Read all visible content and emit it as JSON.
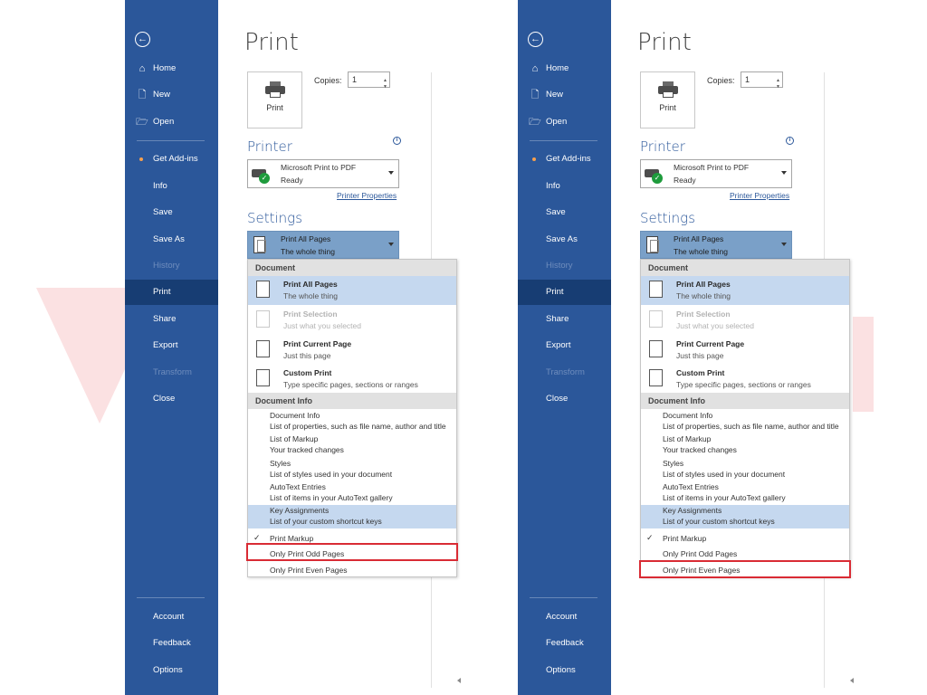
{
  "sidebar": {
    "items": [
      {
        "label": "Home",
        "icon": "home-icon"
      },
      {
        "label": "New",
        "icon": "new-document-icon"
      },
      {
        "label": "Open",
        "icon": "open-folder-icon"
      },
      {
        "label": "Get Add-ins",
        "icon": "addins-dot-icon"
      },
      {
        "label": "Info"
      },
      {
        "label": "Save"
      },
      {
        "label": "Save As"
      },
      {
        "label": "History",
        "disabled": true
      },
      {
        "label": "Print",
        "selected": true
      },
      {
        "label": "Share"
      },
      {
        "label": "Export"
      },
      {
        "label": "Transform",
        "disabled": true
      },
      {
        "label": "Close"
      },
      {
        "label": "Account"
      },
      {
        "label": "Feedback"
      },
      {
        "label": "Options"
      }
    ],
    "back_icon": "back-arrow-icon"
  },
  "main": {
    "title": "Print",
    "print_button": "Print",
    "copies_label": "Copies:",
    "copies_value": "1",
    "printer_heading": "Printer",
    "printer_name": "Microsoft Print to PDF",
    "printer_status": "Ready",
    "printer_properties": "Printer Properties",
    "settings_heading": "Settings",
    "settings_title": "Print All Pages",
    "settings_sub": "The whole thing"
  },
  "menu": {
    "document_head": "Document",
    "items": [
      {
        "title": "Print All Pages",
        "sub": "The whole thing",
        "highlighted": true
      },
      {
        "title": "Print Selection",
        "sub": "Just what you selected",
        "disabled": true
      },
      {
        "title": "Print Current Page",
        "sub": "Just this page"
      },
      {
        "title": "Custom Print",
        "sub": "Type specific pages, sections or ranges"
      }
    ],
    "docinfo_head": "Document Info",
    "docinfo_items": [
      {
        "title": "Document Info",
        "sub": "List of properties, such as file name, author and title"
      },
      {
        "title": "List of Markup",
        "sub": "Your tracked changes"
      },
      {
        "title": "Styles",
        "sub": "List of styles used in your document"
      },
      {
        "title": "AutoText Entries",
        "sub": "List of items in your AutoText gallery"
      },
      {
        "title": "Key Assignments",
        "sub": "List of your custom shortcut keys",
        "highlighted": true
      }
    ],
    "print_markup": "Print Markup",
    "check": "✓",
    "odd_pages": "Only Print Odd Pages",
    "even_pages": "Only Print Even Pages"
  },
  "annotations": {
    "left_highlight": "Only Print Odd Pages",
    "right_highlight": "Only Print Even Pages",
    "highlight_color": "#d92b34"
  },
  "colors": {
    "sidebar": "#2b579a",
    "sidebar_selected": "#173d73",
    "accent": "#2b579a",
    "menu_highlight": "#c5d8ef"
  }
}
